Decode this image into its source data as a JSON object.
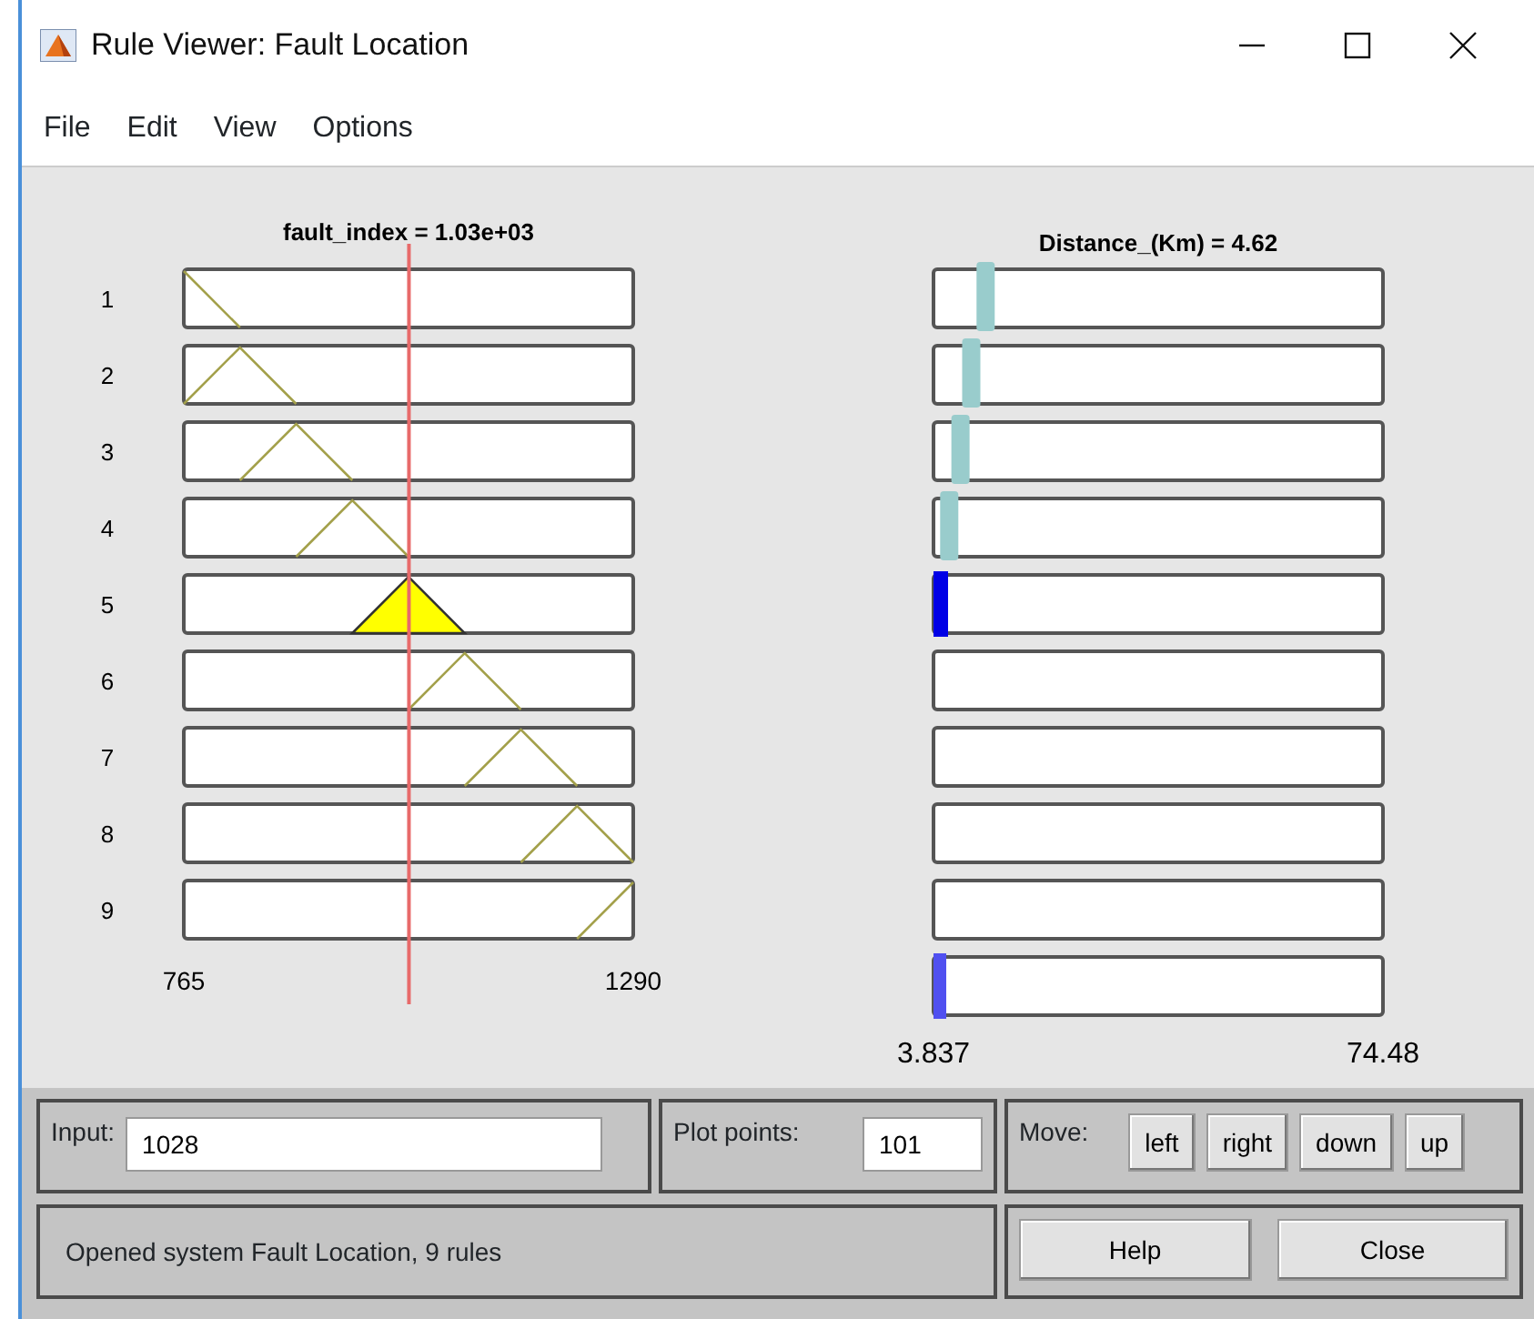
{
  "window": {
    "title": "Rule Viewer: Fault Location"
  },
  "menu": [
    "File",
    "Edit",
    "View",
    "Options"
  ],
  "input_plot": {
    "title": "fault_index = 1.03e+03",
    "min_label": "765",
    "max_label": "1290"
  },
  "output_plot": {
    "title": "Distance_(Km) = 4.62",
    "min_label": "3.837",
    "max_label": "74.48"
  },
  "rules": [
    {
      "number": "1",
      "fired": false
    },
    {
      "number": "2",
      "fired": false
    },
    {
      "number": "3",
      "fired": false
    },
    {
      "number": "4",
      "fired": false
    },
    {
      "number": "5",
      "fired": true
    },
    {
      "number": "6",
      "fired": false
    },
    {
      "number": "7",
      "fired": false
    },
    {
      "number": "8",
      "fired": false
    },
    {
      "number": "9",
      "fired": false
    }
  ],
  "input": {
    "label": "Input:",
    "value": "1028"
  },
  "plot_points": {
    "label": "Plot points:",
    "value": "101"
  },
  "move": {
    "label": "Move:",
    "buttons": [
      "left",
      "right",
      "down",
      "up"
    ]
  },
  "status": "Opened system Fault Location, 9 rules",
  "buttons": [
    "Help",
    "Close"
  ]
}
